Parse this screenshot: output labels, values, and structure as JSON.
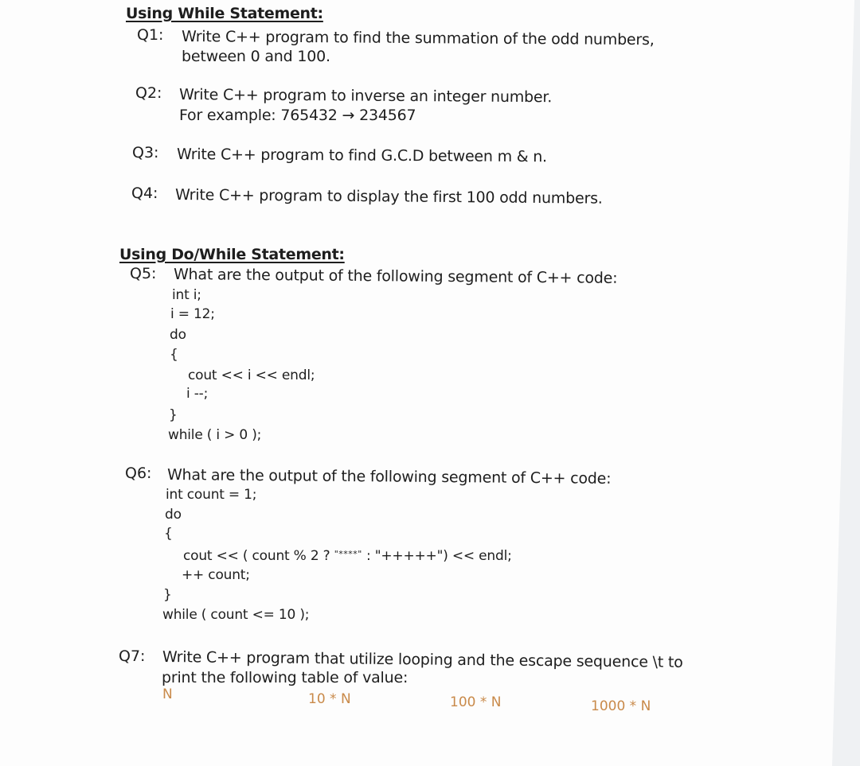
{
  "sections": [
    {
      "heading": "Using While Statement:",
      "questions": [
        {
          "number": "Q1:",
          "lines": [
            "Write  C++  program  to  find  the  summation  of  the  odd  numbers,",
            "between 0 and 100."
          ]
        },
        {
          "number": "Q2:",
          "lines": [
            "Write C++ program to inverse an integer number.",
            "For example:  765432  →  234567"
          ]
        },
        {
          "number": "Q3:",
          "lines": [
            "Write C++ program to find G.C.D between m & n."
          ]
        },
        {
          "number": "Q4:",
          "lines": [
            "Write C++ program to display the first 100 odd numbers."
          ]
        }
      ]
    },
    {
      "heading": "Using Do/While Statement:",
      "questions": [
        {
          "number": "Q5:",
          "lines": [
            "What are the output of the following segment of C++ code:"
          ],
          "code": [
            "int i;",
            "i = 12;",
            "do",
            "{",
            "cout << i << endl;",
            "i --;",
            "}",
            "while ( i > 0 );"
          ]
        },
        {
          "number": "Q6:",
          "lines": [
            "What are the output of the following segment of C++ code:"
          ],
          "code": [
            "int count = 1;",
            "do",
            "{",
            "cout << ( count % 2 ? ",
            "\"****\"",
            " : \"+++++\") << endl;",
            "++ count;",
            "}",
            "while ( count <= 10 );"
          ]
        },
        {
          "number": "Q7:",
          "lines": [
            "Write C++ program that utilize looping and the escape sequence \\t to",
            "print the following table of value:"
          ],
          "table_headers": [
            "N",
            "10 * N",
            "100 * N",
            "1000 * N"
          ]
        }
      ]
    }
  ],
  "colors": {
    "text": "#1e1e1e",
    "table_header": "#c98a4a",
    "paper": "#fdfdfd",
    "edge": "#eff1f3"
  }
}
